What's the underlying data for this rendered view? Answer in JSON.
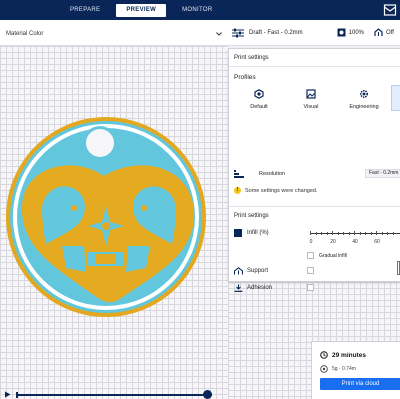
{
  "topbar": {
    "tabs": [
      {
        "label": "PREPARE",
        "active": false
      },
      {
        "label": "PREVIEW",
        "active": true
      },
      {
        "label": "MONITOR",
        "active": false
      }
    ]
  },
  "view": {
    "color_scheme": "Material Color"
  },
  "settings_strip": {
    "profile_summary": "Draft - Fast - 0.2mm",
    "infill": "100%",
    "support": "Off"
  },
  "print_settings": {
    "title": "Print settings",
    "profiles_title": "Profiles",
    "profiles": [
      {
        "label": "Default",
        "icon": "hexagon-icon"
      },
      {
        "label": "Visual",
        "icon": "image-icon"
      },
      {
        "label": "Engineering",
        "icon": "gear-icon"
      }
    ],
    "resolution_label": "Resolution",
    "resolution_value": "Fast - 0.2mm",
    "notice": "Some settings were changed.",
    "section_title": "Print settings",
    "infill_label": "Infill (%)",
    "infill_ticks": [
      "0",
      "20",
      "40",
      "60"
    ],
    "gradual_infill_label": "Gradual infill",
    "support_label": "Support",
    "adhesion_label": "Adhesion"
  },
  "action_panel": {
    "time": "29 minutes",
    "material": "5g · 0.74m",
    "print_button": "Print via cloud"
  },
  "colors": {
    "nav": "#0a2558",
    "accent": "#196ef0",
    "model_cyan": "#62c6dc",
    "model_yellow": "#e4a820"
  }
}
